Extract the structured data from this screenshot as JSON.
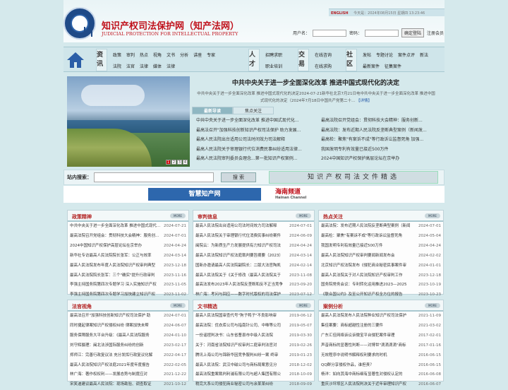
{
  "header": {
    "site_title": "知识产权司法保护网（知产法网）",
    "site_subtitle": "JUDICIAL PROTECTION FOR INTELLECTUAL PROPERTY",
    "english_link": "ENGLISH",
    "date_text": "今天是：2024年08月15日 星期四 13:23:46",
    "username_label": "用户名：",
    "password_label": "密码：",
    "login_button": "确定登陆",
    "register_link": "注册会员"
  },
  "nav": {
    "cat1": "资讯",
    "cat2": "人才",
    "cat3": "交易",
    "cat4": "社区",
    "row1a": [
      "政策",
      "审判",
      "热点",
      "视角",
      "文书",
      "分析",
      "讲座",
      "专家"
    ],
    "row1b": [
      "法院",
      "法官",
      "法律",
      "媒体",
      "法律"
    ],
    "row2a": [
      "招聘求职"
    ],
    "row2b": [
      "职业培训"
    ],
    "row3a": [
      "在线咨询"
    ],
    "row3b": [
      "在线求购"
    ],
    "row4a": [
      "发帖",
      "专题讨论",
      "案件点评",
      "新法"
    ],
    "row4b": [
      "最新案件",
      "征集案件"
    ]
  },
  "hero": {
    "pages": [
      "1",
      "2",
      "3",
      "4"
    ]
  },
  "headline": {
    "title": "中共中央关于进一步全面深化改革 推进中国式现代化的决定",
    "summary": "中共中央关于进一步全面深化改革 推进中国式现代化的决定2024-07-21新华社北京7月21日电中共中央关于进一步全面深化改革 推进中国式现代化的决定（2024年7月18日中国共产党第二十...",
    "more": "【详情】"
  },
  "tabs": [
    "最新导读",
    "焦点关注"
  ],
  "latest_left": [
    "中共中央关于进一步全面深化改革 推进中国式现代化...",
    "最高法召开\"加强科技创新知识产权司法保护 助力发展...",
    "最高人民法院出台适用公司法时间效力司法解释",
    "最高人民法院关于审理银行代位消费民事纠纷适用法律...",
    "最高人民法院审判委员会理念...第一批知识产权案例..."
  ],
  "latest_right": [
    "最高法院召开党组会：贯彻科技大会精神：服务创新...",
    "最高法院：发布近期人民法院反垄断典型案例（新闻发...",
    "最高检：聚焦\"有案诉不成\"等行政诉讼监督死角 加强...",
    "我国发明专利有效量已接近500万件",
    "2024中国知识产权保护高层论坛在京举办"
  ],
  "search": {
    "label": "站内搜索：",
    "button": "搜 索",
    "banner": "知识产权司法文件精选"
  },
  "ads": {
    "ad1": "智慧知产网",
    "ad2": "海南频道",
    "ad2_sub": "Hainan Channel"
  },
  "sections": [
    {
      "title": "政策精神",
      "more": "MORE",
      "rows": [
        {
          "t": "中共中央关于进一步全面深化改革 推进中国式现代化的决定",
          "d": "2024-07-21"
        },
        {
          "t": "最高法院召开党组会：贯彻科技大会精神：服务创新驱动",
          "d": "2024-07-01"
        },
        {
          "t": "2024中国知识产权保护高层论坛在京举办",
          "d": "2024-04-24"
        },
        {
          "t": "新华社专访最高人民法院院长张军：公正与效率",
          "d": "2024-03-14"
        },
        {
          "t": "最高人民法院发布年度人民法院知识产权审判典型",
          "d": "2023-12-18"
        },
        {
          "t": "最高人民法院院长张军：三个\"确实\"提升行政审判",
          "d": "2023-11-16"
        },
        {
          "t": "李强主持国务院第四次专题学习 深入实施知识产权",
          "d": "2023-11-05"
        },
        {
          "t": "李强主持国务院第四次专题学习加快建立知识产权",
          "d": "2023-11-02"
        }
      ]
    },
    {
      "title": "审判信息",
      "more": "MORE",
      "rows": [
        {
          "t": "最高人民法院出台适用公司法时间效力司法解释",
          "d": "2024-07-01"
        },
        {
          "t": "最高人民法院关于审理银行代位消费民事纠纷案件",
          "d": "2024-06-09"
        },
        {
          "t": "闽院云：为新质生产力发展提供有力知识产权司法",
          "d": "2024-04-24"
        },
        {
          "t": "最高人民法院知识产权法庭裁判要旨摘要（2023）",
          "d": "2024-03-14"
        },
        {
          "t": "国新办邀请最高人民法院副院长：二版大法官陶凯",
          "d": "2024-02-14"
        },
        {
          "t": "最高人民法院关于《关于修改〈最高人民法院关于",
          "d": "2023-11-08"
        },
        {
          "t": "最高法发布2023年人民法院反垄断和反不正当竞争",
          "d": "2023-09-20"
        },
        {
          "t": "林广海：考问与回应——数字时代版权的司法保护",
          "d": "2023-07-12"
        }
      ]
    },
    {
      "title": "热点关注",
      "more": "MORE",
      "rows": [
        {
          "t": "最高法院：发布近期人民法院反垄断典型案例（新闻",
          "d": "2024-07-01"
        },
        {
          "t": "最高检：聚焦\"有案诉不成\"等行政诉讼监督死角",
          "d": "2024-05-04"
        },
        {
          "t": "我国发明专利有效量已接近500万件",
          "d": "2024-04-24"
        },
        {
          "t": "最高人民法院知识产权审判要闻新闻发布会",
          "d": "2024-02-02"
        },
        {
          "t": "北京知识产权法院发布《侵犯商业秘密民事案件审",
          "d": "2024-01-01"
        },
        {
          "t": "最高人民法院关于对人民法院知识产权审判工作",
          "d": "2023-12-18"
        },
        {
          "t": "国务院常务会议：专利转化运用推进2023—2025",
          "d": "2023-10-19"
        },
        {
          "t": "《联合国公约》及至公开知识产权全方位的报告",
          "d": "2023-10-23"
        }
      ]
    },
    {
      "title": "法官视角",
      "more": "MORE",
      "rows": [
        {
          "t": "最高法召开\"加强科技创新知识产权司法保护 助",
          "d": "2024-07-01"
        },
        {
          "t": "同时捷起律案知识产权侵权纠纷 律案加快未帮",
          "d": "2024-06-07"
        },
        {
          "t": "服务保障服务大平台升级：《最高人民法院服务",
          "d": "2024-01-10"
        },
        {
          "t": "刘守辉摄理：闽北法涉国际服务纠纷的创新",
          "d": "2023-02-17"
        },
        {
          "t": "郑师江：完善行政复议法 充分发挥行政复议化解",
          "d": "2022-04-17"
        },
        {
          "t": "最高人民法院知识产权法庭2021年度年度报告",
          "d": "2022-02-05"
        },
        {
          "t": "林广海：著作权权利——发展态势与制度应对",
          "d": "2021-12-22"
        },
        {
          "t": "宋笑迪建议最高人民法院：现场勘验、调查取证",
          "d": "2021-10-12"
        }
      ]
    },
    {
      "title": "文书精选",
      "more": "MORE",
      "rows": [
        {
          "t": "最高人民法院国审查代号\"狗子鸭子\"不良影响审",
          "d": "2019-06-12"
        },
        {
          "t": "最高法院：优衣库公司与指南针公司、中唯等公司",
          "d": "2019-05-07"
        },
        {
          "t": "一份谣捏判决书：山东省曹县市中级人民法院",
          "d": "2019-03-30"
        },
        {
          "t": "关于：河南省法院知识产权审判二庭审判法官对",
          "d": "2019-02-26"
        },
        {
          "t": "腾讯上海公司与锦新华因竞争服判纠纷一案 终审",
          "d": "2019-01-23"
        },
        {
          "t": "最高人民法院：武汉中磁公司与商标局案意见分",
          "d": "2018-12-02"
        },
        {
          "t": "最高法院重案裁判利浦有限公司与超人集团有限公",
          "d": "2018-10-09"
        },
        {
          "t": "稍完大系公司侵犯商业秘密公司与余某某纠纷",
          "d": "2018-09-09"
        }
      ]
    },
    {
      "title": "案例分析",
      "more": "MORE",
      "rows": [
        {
          "t": "最高人民法院发布人民法院种业知识产权司法保护",
          "d": "2021-11-09"
        },
        {
          "t": "集佳案要：商标超越性注册的三要件",
          "d": "2021-03-02"
        },
        {
          "t": "广东汇佳网络诉讼诉微宝平台侵犯案件审理",
          "d": "2017-02-01"
        },
        {
          "t": "声音商标的显著性判断——对博世\"滴滴滴滴\"商标",
          "d": "2017-01-16"
        },
        {
          "t": "无效程序中说明书解释权利要求的时机",
          "d": "2016-06-15"
        },
        {
          "t": "QQ群分享侵权作品，谁担责？",
          "d": "2016-06-15"
        },
        {
          "t": "杨洋：如向其海中商标细有显著性对侵权认定的",
          "d": "2016-06-08"
        },
        {
          "t": "重庆沙坪坝区人民法院判决关于近年审理知识产权",
          "d": "2016-06-07"
        }
      ]
    }
  ]
}
